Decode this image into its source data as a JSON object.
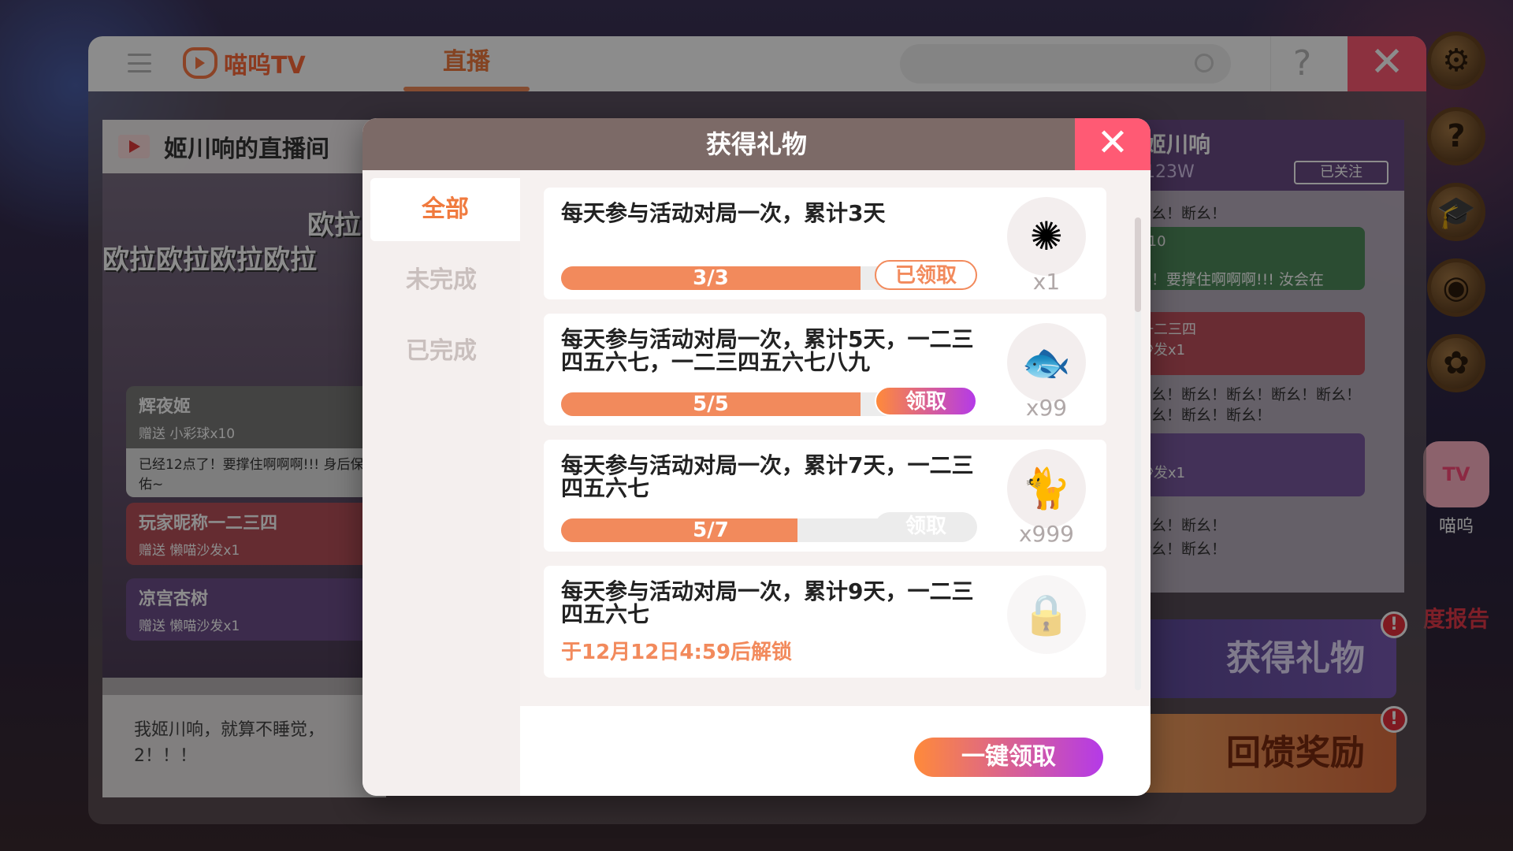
{
  "app": {
    "logo_text": "喵呜TV",
    "tab_live": "直播",
    "help": "?",
    "close": "✕"
  },
  "stream": {
    "title": "姬川响的直播间",
    "danmaku_1": "欧拉",
    "danmaku_2": "欧拉欧拉欧拉欧拉",
    "gifts": [
      {
        "name": "辉夜姬",
        "gift": "赠送 小彩球x10",
        "msg": "已经12点了！要撑住啊啊啊!!! 身后保佑~",
        "color": "#7a7a78"
      },
      {
        "name": "玩家昵称一二三四",
        "gift": "赠送 懒喵沙发x1",
        "msg": "",
        "color": "#b8505a"
      },
      {
        "name": "凉宫杏树",
        "gift": "赠送 懒喵沙发x1",
        "msg": "",
        "color": "#6e4f8a"
      }
    ],
    "anchor_msg": "我姬川响，就算不睡觉，2！！！"
  },
  "chat": {
    "name": "姬川响",
    "fans": "123W",
    "follow": "已关注",
    "lines": [
      "断幺！断幺！",
      "了！要撑住啊啊啊!!! 汝会在",
      "断幺！断幺！断幺！断幺！断幺！",
      "断幺！断幺！断幺！",
      "断幺！断幺！",
      "断幺！断幺！"
    ],
    "card_1": "x10",
    "card_2_name": "一二三四",
    "card_2_gift": "沙发x1",
    "card_3_gift": "沙发x1",
    "btn_gift": "获得礼物",
    "btn_reward": "回馈奖励",
    "badge": "!"
  },
  "rail": {
    "tv_label": "喵呜",
    "tv_icon": "TV",
    "report": "度报告"
  },
  "modal": {
    "title": "获得礼物",
    "close": "✕",
    "tabs": [
      "全部",
      "未完成",
      "已完成"
    ],
    "tasks": [
      {
        "title": "每天参与活动对局一次，累计3天",
        "progress_label": "3/3",
        "progress": 1.0,
        "button": "已领取",
        "state": "done",
        "reward_icon": "pompom-icon",
        "reward_glyph": "✺",
        "qty": "x1"
      },
      {
        "title": "每天参与活动对局一次，累计5天，一二三四五六七，一二三四五六七八九",
        "progress_label": "5/5",
        "progress": 1.0,
        "button": "领取",
        "state": "active",
        "reward_icon": "taiyaki-icon",
        "reward_glyph": "🐟",
        "qty": "x99"
      },
      {
        "title": "每天参与活动对局一次，累计7天，一二三四五六七",
        "progress_label": "5/7",
        "progress": 0.714,
        "button": "领取",
        "state": "off",
        "reward_icon": "cat-icon",
        "reward_glyph": "🐈",
        "qty": "x999"
      },
      {
        "title": "每天参与活动对局一次，累计9天，一二三四五六七",
        "unlock": "于12月12日4:59后解锁",
        "state": "locked",
        "reward_icon": "lock-icon",
        "reward_glyph": "🔒"
      }
    ],
    "claim_all": "一键领取"
  }
}
